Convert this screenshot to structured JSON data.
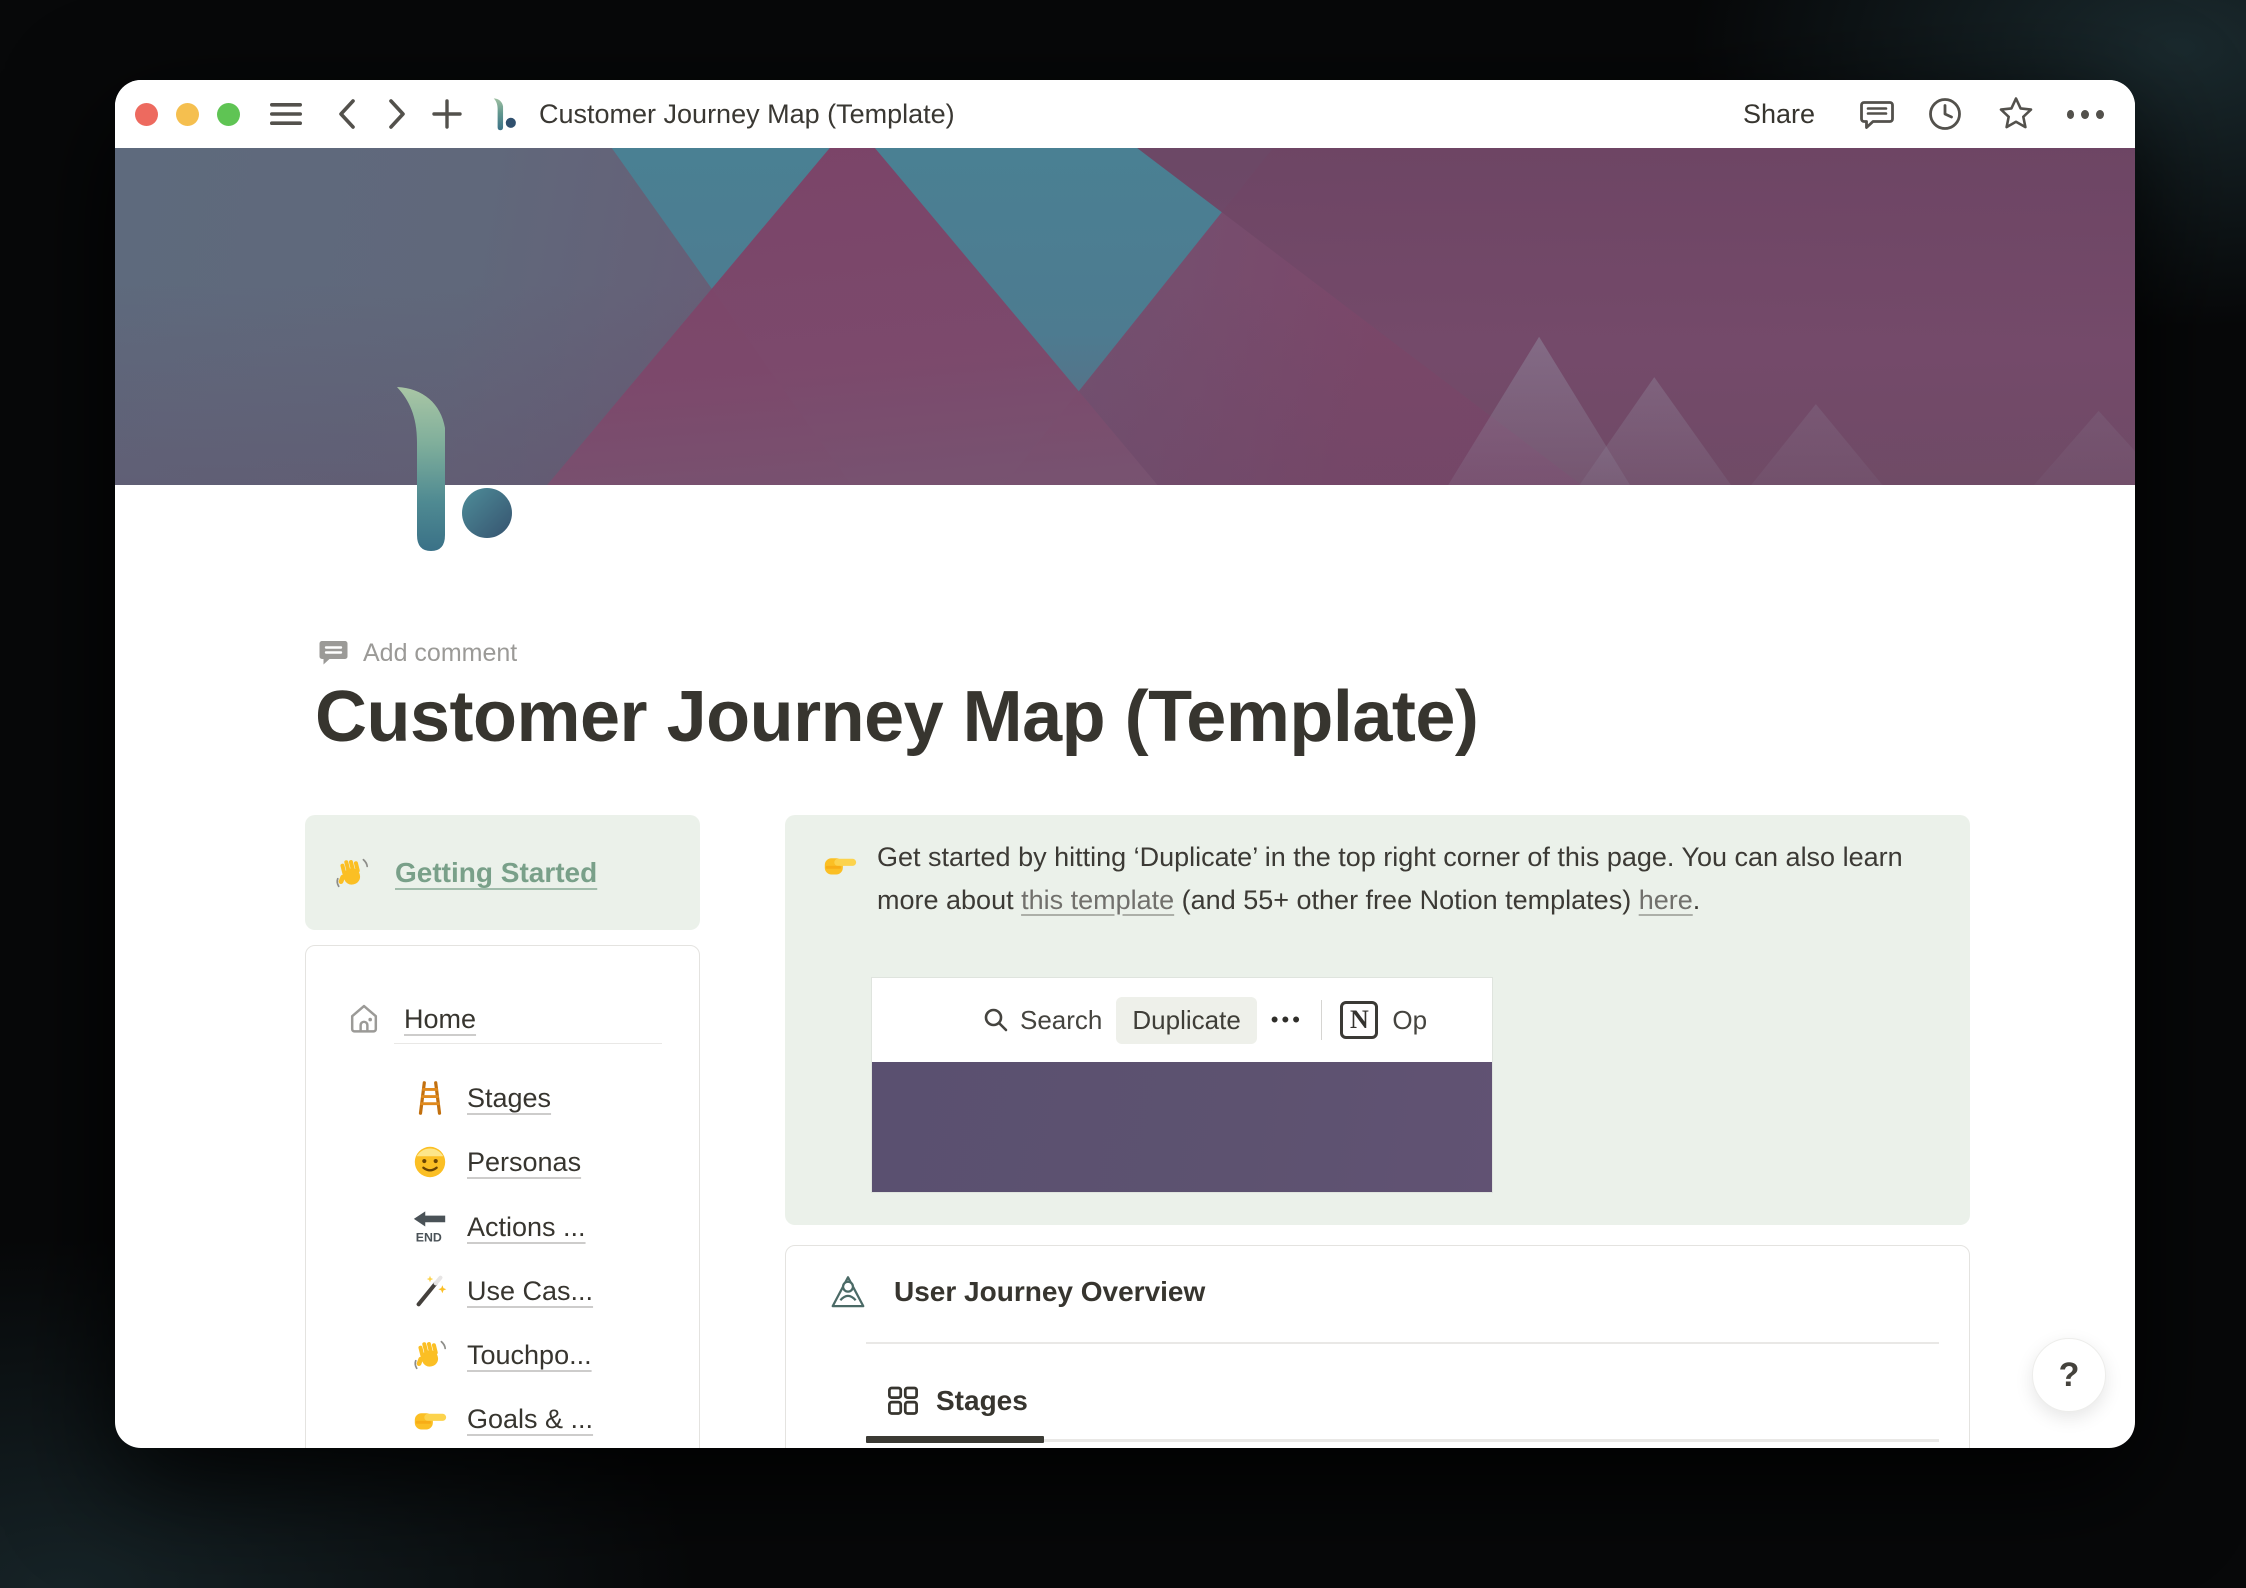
{
  "titlebar": {
    "title": "Customer Journey Map (Template)",
    "share_label": "Share"
  },
  "page": {
    "add_comment_label": "Add comment",
    "title": "Customer Journey Map (Template)"
  },
  "getting_started": {
    "label": "Getting Started"
  },
  "nav_card": {
    "home_label": "Home",
    "items": [
      {
        "label": "Stages",
        "icon": "ladder-emoji"
      },
      {
        "label": "Personas",
        "icon": "smiley-face-emoji"
      },
      {
        "label": "Actions ...",
        "icon": "end-arrow-emoji"
      },
      {
        "label": "Use Cas...",
        "icon": "magic-wand-emoji"
      },
      {
        "label": "Touchpo...",
        "icon": "waving-hand-emoji"
      },
      {
        "label": "Goals & ...",
        "icon": "pointing-right-emoji"
      }
    ]
  },
  "callout": {
    "icon": "pointing-right-emoji",
    "text_part1": "Get started by hitting ‘Duplicate’ in the top right corner of this page. You can also learn more about ",
    "link1": "this template",
    "text_part2": " (and 55+ other free Notion templates) ",
    "link2": "here",
    "text_part3": "."
  },
  "embed_screenshot": {
    "search_label": "Search",
    "duplicate_label": "Duplicate",
    "ellipsis": "•••",
    "notion_letter": "N",
    "open_label": "Op"
  },
  "overview": {
    "title": "User Journey Overview",
    "tab_label": "Stages"
  },
  "help_label": "?",
  "icons": {
    "titlebar_left": [
      "menu-icon",
      "back-icon",
      "forward-icon",
      "new-tab-icon",
      "app-logo-icon"
    ],
    "titlebar_right": [
      "comment-icon",
      "history-clock-icon",
      "favorite-star-icon",
      "more-ellipsis-icon"
    ],
    "page": [
      "comment-bubble-icon",
      "home-icon",
      "person-triangle-icon",
      "grid-gallery-icon",
      "search-icon",
      "notion-logo-icon"
    ]
  },
  "colors": {
    "callout_bg": "#ebf1ea",
    "getting_started_green": "#79a089",
    "embed_purple": "#5d5270",
    "cover_teal": "#4a8093",
    "cover_plum": "#7b4769",
    "cover_slate": "#5e6a7d",
    "traffic_red": "#ed6a5f",
    "traffic_yellow": "#f5bf4f",
    "traffic_green": "#5fc454",
    "text_dark": "#37352f",
    "text_gray": "#9b9a97"
  }
}
